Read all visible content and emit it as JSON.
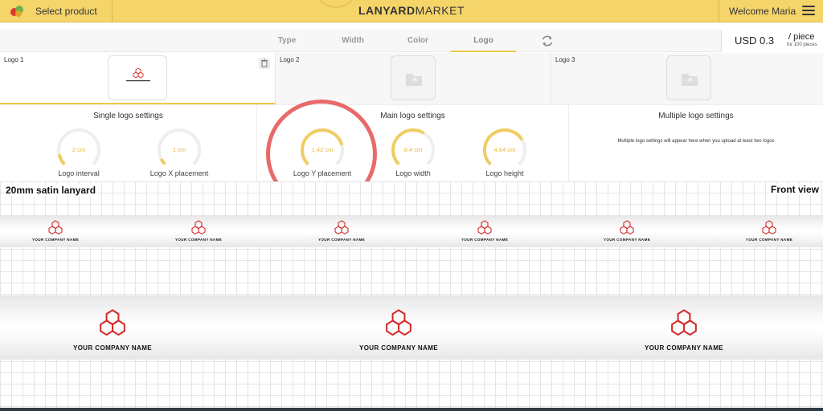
{
  "topbar": {
    "select_label": "Select product",
    "brand_bold": "LANYARD",
    "brand_light": "MARKET",
    "welcome": "Welcome Maria"
  },
  "tabs": [
    {
      "label": "Type"
    },
    {
      "label": "Width"
    },
    {
      "label": "Color"
    },
    {
      "label": "Logo"
    }
  ],
  "price": {
    "amount": "USD 0.3",
    "unit": "/ piece",
    "note": "for 100 pieces"
  },
  "logos": [
    {
      "name": "Logo 1"
    },
    {
      "name": "Logo 2"
    },
    {
      "name": "Logo 3"
    }
  ],
  "settings": {
    "single": {
      "title": "Single logo settings",
      "gauges": [
        {
          "value": "2 cm",
          "label": "Logo interval",
          "level": 0.12
        },
        {
          "value": "1 cm",
          "label": "Logo X placement",
          "level": 0.07
        }
      ]
    },
    "main": {
      "title": "Main logo settings",
      "gauges": [
        {
          "value": "1.42 cm",
          "label": "Logo Y placement",
          "level": 0.78
        },
        {
          "value": "8.4 cm",
          "label": "Logo width",
          "level": 0.62
        },
        {
          "value": "4.64 cm",
          "label": "Logo height",
          "level": 0.72
        }
      ]
    },
    "multiple": {
      "title": "Multiple logo settings",
      "message": "Multiple logo settings will appear here when you upload at least two logos"
    }
  },
  "preview": {
    "lanyard_name": "20mm satin lanyard",
    "view": "Front view",
    "company_name": "YOUR COMPANY NAME"
  },
  "colors": {
    "accent": "#f5d56a",
    "gauge": "#f0cd63",
    "logo_red": "#d42a2a",
    "highlight": "#e86a6a"
  }
}
